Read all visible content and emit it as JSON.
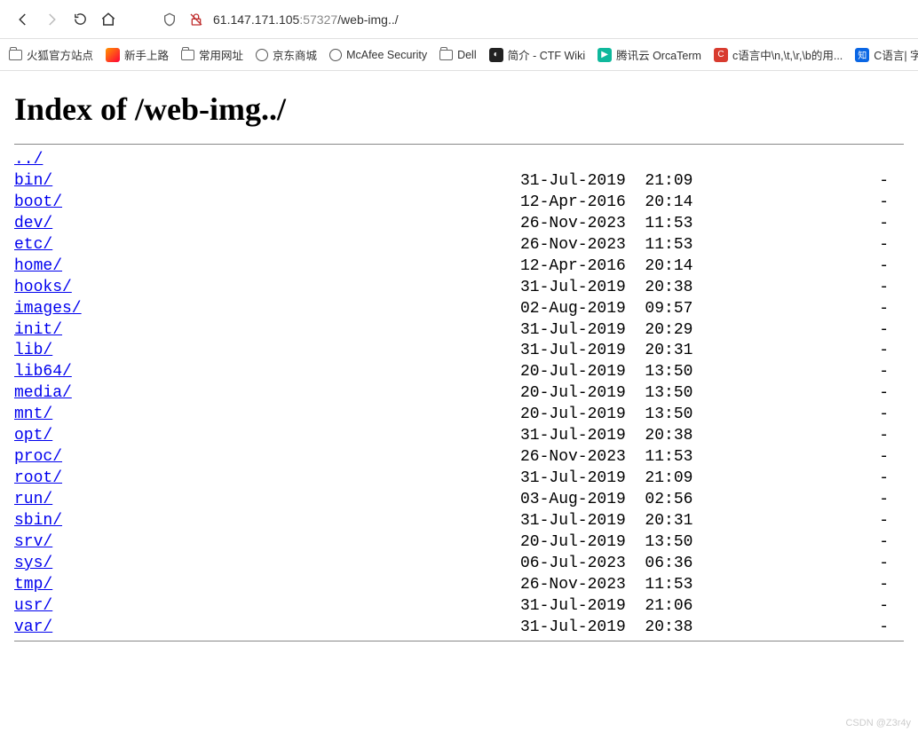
{
  "url": {
    "host": "61.147.171.105",
    "port": ":57327",
    "path": "/web-img../"
  },
  "bookmarks": [
    {
      "label": "火狐官方站点",
      "icon": "folder"
    },
    {
      "label": "新手上路",
      "icon": "firefox"
    },
    {
      "label": "常用网址",
      "icon": "folder"
    },
    {
      "label": "京东商城",
      "icon": "globe"
    },
    {
      "label": "McAfee Security",
      "icon": "globe"
    },
    {
      "label": "Dell",
      "icon": "folder"
    },
    {
      "label": "简介 - CTF Wiki",
      "icon": "dark"
    },
    {
      "label": "腾讯云 OrcaTerm",
      "icon": "teal"
    },
    {
      "label": "c语言中\\n,\\t,\\r,\\b的用...",
      "icon": "red-c"
    },
    {
      "label": "C语言| 字符串",
      "icon": "blue-zhi"
    }
  ],
  "heading": "Index of /web-img../",
  "parent_link": "../",
  "entries": [
    {
      "name": "bin/",
      "date": "31-Jul-2019  21:09",
      "size": "-"
    },
    {
      "name": "boot/",
      "date": "12-Apr-2016  20:14",
      "size": "-"
    },
    {
      "name": "dev/",
      "date": "26-Nov-2023  11:53",
      "size": "-"
    },
    {
      "name": "etc/",
      "date": "26-Nov-2023  11:53",
      "size": "-"
    },
    {
      "name": "home/",
      "date": "12-Apr-2016  20:14",
      "size": "-"
    },
    {
      "name": "hooks/",
      "date": "31-Jul-2019  20:38",
      "size": "-"
    },
    {
      "name": "images/",
      "date": "02-Aug-2019  09:57",
      "size": "-"
    },
    {
      "name": "init/",
      "date": "31-Jul-2019  20:29",
      "size": "-"
    },
    {
      "name": "lib/",
      "date": "31-Jul-2019  20:31",
      "size": "-"
    },
    {
      "name": "lib64/",
      "date": "20-Jul-2019  13:50",
      "size": "-"
    },
    {
      "name": "media/",
      "date": "20-Jul-2019  13:50",
      "size": "-"
    },
    {
      "name": "mnt/",
      "date": "20-Jul-2019  13:50",
      "size": "-"
    },
    {
      "name": "opt/",
      "date": "31-Jul-2019  20:38",
      "size": "-"
    },
    {
      "name": "proc/",
      "date": "26-Nov-2023  11:53",
      "size": "-"
    },
    {
      "name": "root/",
      "date": "31-Jul-2019  21:09",
      "size": "-"
    },
    {
      "name": "run/",
      "date": "03-Aug-2019  02:56",
      "size": "-"
    },
    {
      "name": "sbin/",
      "date": "31-Jul-2019  20:31",
      "size": "-"
    },
    {
      "name": "srv/",
      "date": "20-Jul-2019  13:50",
      "size": "-"
    },
    {
      "name": "sys/",
      "date": "06-Jul-2023  06:36",
      "size": "-"
    },
    {
      "name": "tmp/",
      "date": "26-Nov-2023  11:53",
      "size": "-"
    },
    {
      "name": "usr/",
      "date": "31-Jul-2019  21:06",
      "size": "-"
    },
    {
      "name": "var/",
      "date": "31-Jul-2019  20:38",
      "size": "-"
    }
  ],
  "watermark": "CSDN @Z3r4y"
}
